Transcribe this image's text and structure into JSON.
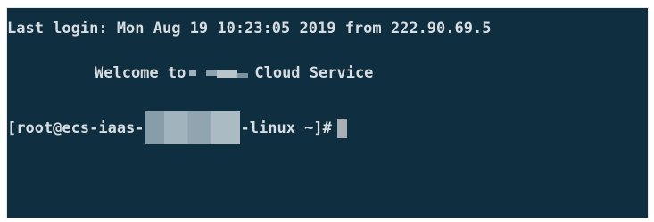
{
  "terminal": {
    "last_login": "Last login: Mon Aug 19 10:23:05 2019 from 222.90.69.5",
    "welcome_prefix": "Welcome to",
    "welcome_suffix": "Cloud Service",
    "prompt_prefix": "[root@ecs-iaas-",
    "prompt_suffix": "-linux ~]#"
  },
  "colors": {
    "background": "#0f2f40",
    "text": "#d7dde0",
    "cursor": "#a7b0b5"
  },
  "icons": {
    "cursor": "block-cursor-icon"
  }
}
